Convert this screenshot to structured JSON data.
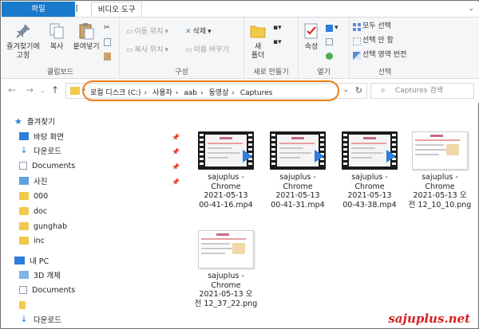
{
  "tabs": [
    {
      "label": "파일"
    },
    {
      "label": "홈"
    },
    {
      "label": "공유"
    },
    {
      "label": "보기"
    },
    {
      "label": "비디오 도구"
    }
  ],
  "ribbon": {
    "clipboard": {
      "pin_label_1": "즐겨찾기에",
      "pin_label_2": "고정",
      "copy_label": "복사",
      "paste_label": "붙여넣기",
      "group_label": "클립보드"
    },
    "organize": {
      "move_to": "이동 위치",
      "copy_to": "복사 위치",
      "delete": "삭제",
      "rename": "이름 바꾸기",
      "group_label": "구성"
    },
    "new": {
      "new_folder_1": "새",
      "new_folder_2": "폴더",
      "group_label": "새로 만들기"
    },
    "open": {
      "properties": "속성",
      "group_label": "열기"
    },
    "select": {
      "select_all": "모두 선택",
      "select_none": "선택 안 함",
      "invert": "선택 영역 반전",
      "group_label": "선택"
    }
  },
  "address": {
    "crumbs": [
      "로컬 디스크 (C:)",
      "사용자",
      "aab",
      "동영상",
      "Captures"
    ],
    "search_placeholder": "Captures 검색"
  },
  "nav": {
    "quick_access": "즐겨찾기",
    "items": [
      {
        "label": "바탕 화면",
        "icon": "desktop-icon"
      },
      {
        "label": "다운로드",
        "icon": "download-icon"
      },
      {
        "label": "Documents",
        "icon": "document-icon"
      },
      {
        "label": "사진",
        "icon": "pictures-icon"
      },
      {
        "label": "000",
        "icon": "folder-icon"
      },
      {
        "label": "doc",
        "icon": "folder-icon"
      },
      {
        "label": "gunghab",
        "icon": "folder-icon"
      },
      {
        "label": "inc",
        "icon": "folder-icon"
      }
    ],
    "this_pc": "내 PC",
    "pc_items": [
      {
        "label": "3D 개체",
        "icon": "3d-objects-icon"
      },
      {
        "label": "Documents",
        "icon": "document-icon"
      },
      {
        "label": "",
        "icon": "file-icon"
      },
      {
        "label": "다운로드",
        "icon": "download-icon"
      }
    ]
  },
  "files": [
    {
      "line1": "sajuplus -",
      "line2": "Chrome",
      "line3": "2021-05-13",
      "line4": "00-41-16.mp4",
      "type": "video"
    },
    {
      "line1": "sajuplus -",
      "line2": "Chrome",
      "line3": "2021-05-13",
      "line4": "00-41-31.mp4",
      "type": "video"
    },
    {
      "line1": "sajuplus -",
      "line2": "Chrome",
      "line3": "2021-05-13",
      "line4": "00-43-38.mp4",
      "type": "video"
    },
    {
      "line1": "sajuplus -",
      "line2": "Chrome",
      "line3": "2021-05-13 오",
      "line4": "전 12_10_10.png",
      "type": "image"
    },
    {
      "line1": "sajuplus -",
      "line2": "Chrome",
      "line3": "2021-05-13 오",
      "line4": "전 12_37_22.png",
      "type": "image"
    }
  ],
  "watermark": "sajuplus.net",
  "colors": {
    "accent": "#1979ca",
    "highlight_oval": "#ee7b14",
    "watermark": "#d62020"
  }
}
